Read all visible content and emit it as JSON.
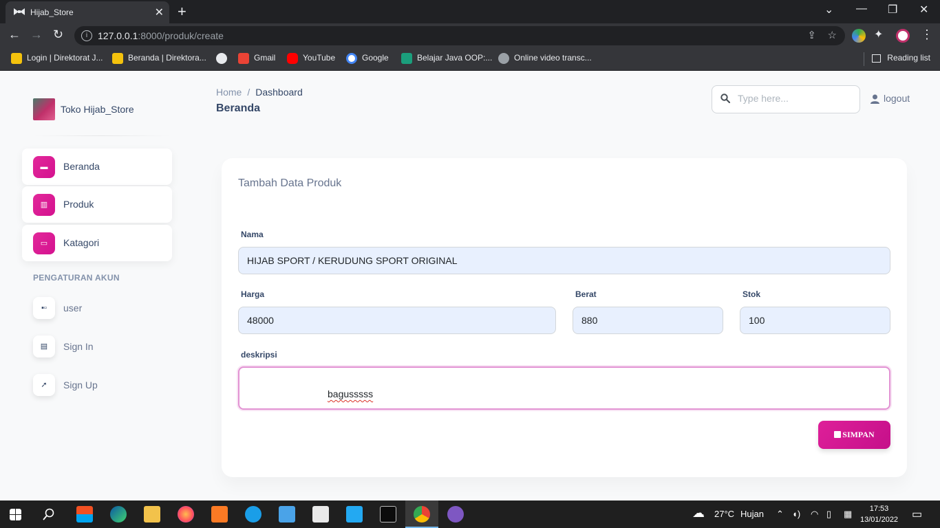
{
  "browser": {
    "tab_title": "Hijab_Store",
    "url_host": "127.0.0.1",
    "url_rest": ":8000/produk/create",
    "bookmarks": [
      {
        "label": "Login | Direktorat J...",
        "color": "#f4c20d"
      },
      {
        "label": "Beranda | Direktora...",
        "color": "#f4c20d"
      },
      {
        "label": "",
        "color": "#ffffff"
      },
      {
        "label": "Gmail",
        "color": "#ea4335"
      },
      {
        "label": "YouTube",
        "color": "#ff0000"
      },
      {
        "label": "Google",
        "color": "#4285f4"
      },
      {
        "label": "Belajar Java OOP:...",
        "color": "#1b9e7c"
      },
      {
        "label": "Online video transc...",
        "color": "#9aa0a6"
      }
    ],
    "reading_list": "Reading list"
  },
  "sidebar": {
    "brand": "Toko Hijab_Store",
    "items": [
      {
        "label": "Beranda",
        "icon": "shop-icon"
      },
      {
        "label": "Produk",
        "icon": "office-icon"
      },
      {
        "label": "Katagori",
        "icon": "credit-card-icon"
      }
    ],
    "section_title": "PENGATURAN AKUN",
    "account_items": [
      {
        "label": "user",
        "icon": "user-card-icon"
      },
      {
        "label": "Sign In",
        "icon": "document-icon"
      },
      {
        "label": "Sign Up",
        "icon": "rocket-icon"
      }
    ]
  },
  "header": {
    "breadcrumb_home": "Home",
    "breadcrumb_sep": "/",
    "breadcrumb_current": "Dashboard",
    "page_title": "Beranda",
    "search_placeholder": "Type here...",
    "logout_label": "logout"
  },
  "form": {
    "title": "Tambah Data Produk",
    "nama_label": "Nama",
    "nama_value": "HIJAB SPORT / KERUDUNG SPORT ORIGINAL",
    "harga_label": "Harga",
    "harga_value": "48000",
    "berat_label": "Berat",
    "berat_value": "880",
    "stok_label": "Stok",
    "stok_value": "100",
    "deskripsi_label": "deskripsi",
    "deskripsi_value": "bagusssss",
    "save_label": "SIMPAN"
  },
  "taskbar": {
    "weather_temp": "27°C",
    "weather_text": "Hujan",
    "time": "17:53",
    "date": "13/01/2022"
  },
  "colors": {
    "accent": "#d4128f",
    "textarea_focus": "#e293d3",
    "input_fill": "#e8f0fe"
  }
}
